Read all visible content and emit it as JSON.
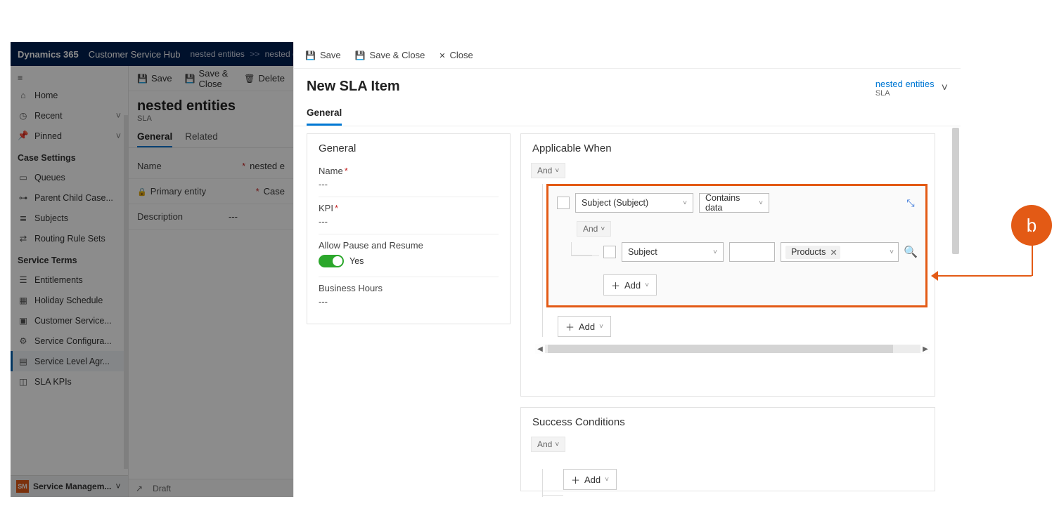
{
  "bg": {
    "brand": "Dynamics 365",
    "hub": "Customer Service Hub",
    "breadcrumb": {
      "item1": "nested entities",
      "item2": "nested entities"
    },
    "cmdbar": {
      "save": "Save",
      "saveClose": "Save & Close",
      "delete": "Delete"
    },
    "title": "nested entities",
    "subtitle": "SLA",
    "tabs": {
      "general": "General",
      "related": "Related"
    },
    "form": {
      "name_label": "Name",
      "name_value": "nested e",
      "primary_label": "Primary entity",
      "primary_value": "Case",
      "desc_label": "Description",
      "desc_value": "---"
    },
    "sidebar": {
      "home": "Home",
      "recent": "Recent",
      "pinned": "Pinned",
      "case_settings": "Case Settings",
      "queues": "Queues",
      "parent_child": "Parent Child Case...",
      "subjects": "Subjects",
      "routing": "Routing Rule Sets",
      "service_terms": "Service Terms",
      "entitlements": "Entitlements",
      "holiday": "Holiday Schedule",
      "customer_service": "Customer Service...",
      "service_config": "Service Configura...",
      "sla": "Service Level Agr...",
      "sla_kpis": "SLA KPIs",
      "area_badge": "SM",
      "area": "Service Managem..."
    },
    "footer": {
      "status": "Draft"
    }
  },
  "panel": {
    "cmdbar": {
      "save": "Save",
      "saveClose": "Save & Close",
      "close": "Close"
    },
    "title": "New SLA Item",
    "head_link": "nested entities",
    "head_sub": "SLA",
    "tabs": {
      "general": "General"
    },
    "general_card": {
      "header": "General",
      "name_label": "Name",
      "name_value": "---",
      "kpi_label": "KPI",
      "kpi_value": "---",
      "allow_label": "Allow Pause and Resume",
      "allow_value": "Yes",
      "bh_label": "Business Hours",
      "bh_value": "---"
    },
    "applicable": {
      "header": "Applicable When",
      "root_op": "And",
      "cond1_field": "Subject (Subject)",
      "cond1_op": "Contains data",
      "inner_op": "And",
      "cond2_field": "Subject",
      "cond2_value_tag": "Products",
      "add": "Add"
    },
    "success": {
      "header": "Success Conditions",
      "root_op": "And",
      "add": "Add"
    }
  },
  "callout": {
    "label": "b"
  }
}
